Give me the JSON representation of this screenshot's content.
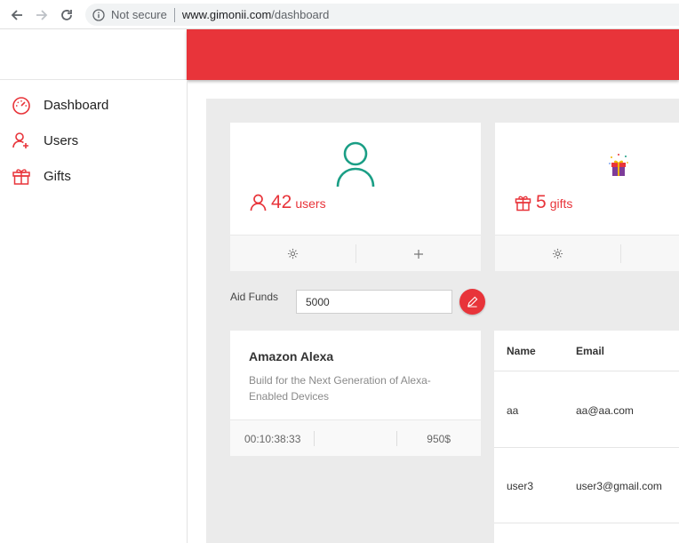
{
  "browser": {
    "security_label": "Not secure",
    "url_host": "www.gimonii.com",
    "url_path": "/dashboard"
  },
  "sidebar": {
    "items": [
      {
        "label": "Dashboard",
        "icon": "speedometer-icon"
      },
      {
        "label": "Users",
        "icon": "add-user-icon"
      },
      {
        "label": "Gifts",
        "icon": "gift-icon"
      }
    ]
  },
  "stats": {
    "users": {
      "count": "42",
      "unit": "users",
      "icon": "user-icon",
      "color": "#e8343a",
      "avatar_color": "#1a9e85"
    },
    "gifts": {
      "count": "5",
      "unit": "gifts",
      "icon": "gift-icon"
    }
  },
  "funds": {
    "label": "Aid Funds",
    "value": "5000"
  },
  "gift_card": {
    "title": "Amazon Alexa",
    "description": "Build for the Next Generation of Alexa-Enabled Devices",
    "time": "00:10:38:33",
    "price": "950$"
  },
  "users_table": {
    "columns": [
      "Name",
      "Email"
    ],
    "rows": [
      {
        "name": "aa",
        "email": "aa@aa.com"
      },
      {
        "name": "user3",
        "email": "user3@gmail.com"
      }
    ]
  },
  "colors": {
    "accent": "#e8343a",
    "avatar_teal": "#1a9e85",
    "main_bg": "#ebebeb"
  }
}
